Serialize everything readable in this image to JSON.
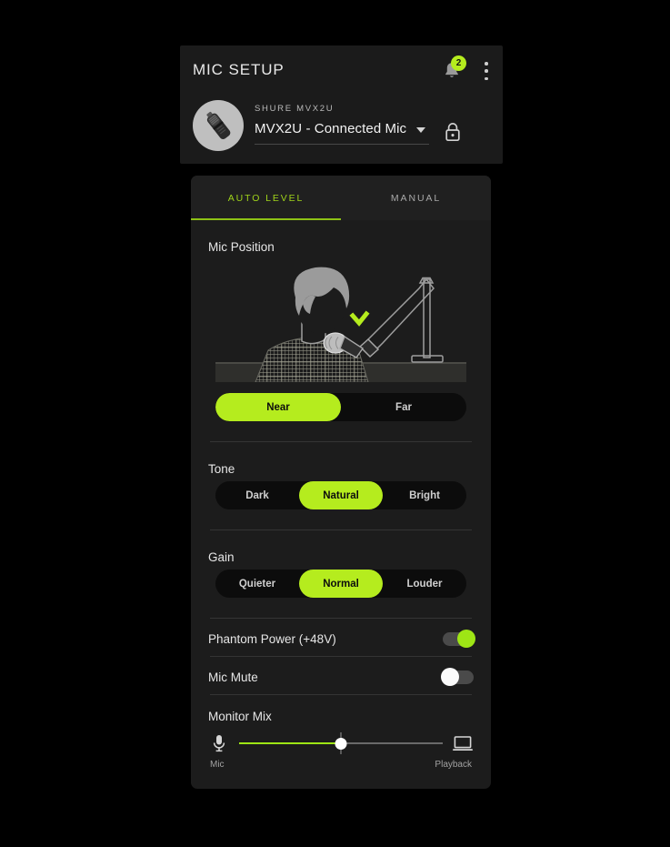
{
  "header": {
    "title": "MIC SETUP",
    "notification_icon": "bell-icon",
    "notification_count": "2",
    "overflow_icon": "kebab-menu-icon",
    "device_avatar_icon": "microphone-icon",
    "device_brand": "SHURE MVX2U",
    "device_selected": "MVX2U - Connected Mic",
    "device_chevron_icon": "chevron-down-icon",
    "lock_icon": "lock-closed-icon"
  },
  "tabs": [
    {
      "label": "AUTO LEVEL",
      "active": true
    },
    {
      "label": "MANUAL",
      "active": false
    }
  ],
  "sections": {
    "mic_position": {
      "label": "Mic Position",
      "illustration": "person-with-boom-mic-illustration",
      "options": [
        {
          "label": "Near",
          "selected": true
        },
        {
          "label": "Far",
          "selected": false
        }
      ]
    },
    "tone": {
      "label": "Tone",
      "options": [
        {
          "label": "Dark",
          "selected": false
        },
        {
          "label": "Natural",
          "selected": true
        },
        {
          "label": "Bright",
          "selected": false
        }
      ]
    },
    "gain": {
      "label": "Gain",
      "options": [
        {
          "label": "Quieter",
          "selected": false
        },
        {
          "label": "Normal",
          "selected": true
        },
        {
          "label": "Louder",
          "selected": false
        }
      ]
    },
    "phantom_power": {
      "label": "Phantom Power (+48V)",
      "state": "on"
    },
    "mic_mute": {
      "label": "Mic Mute",
      "state": "off"
    },
    "monitor_mix": {
      "label": "Monitor Mix",
      "left_icon": "microphone-icon",
      "right_icon": "laptop-icon",
      "left_caption": "Mic",
      "right_caption": "Playback",
      "value_percent": 50
    }
  },
  "colors": {
    "accent_green": "#b5ec1e",
    "accent_green_dim": "#9ee515",
    "page_background": "#000000",
    "panel_background": "#1b1b1b",
    "card_background": "#1c1c1c"
  }
}
